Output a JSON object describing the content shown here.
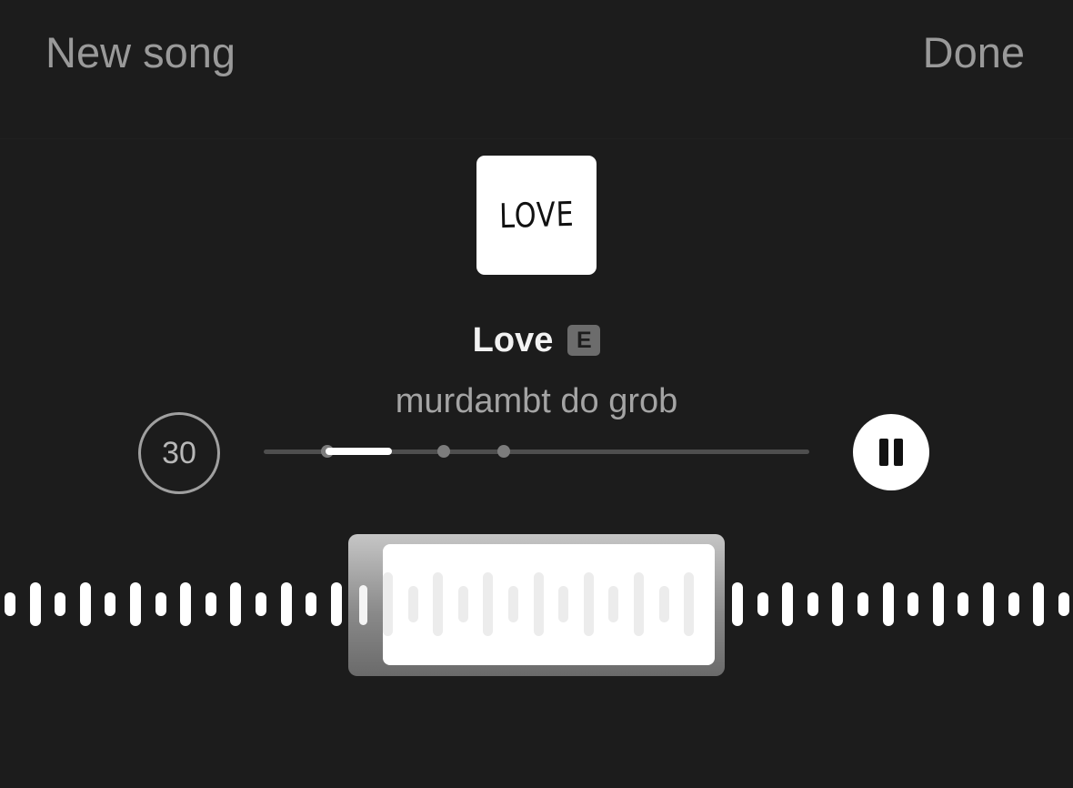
{
  "header": {
    "left_label": "New song",
    "right_label": "Done"
  },
  "album": {
    "art_text": "LOVE"
  },
  "track": {
    "title": "Love",
    "explicit_badge": "E",
    "artist": "murdambt do grob"
  },
  "controls": {
    "duration_label": "30"
  },
  "colors": {
    "background": "#1c1c1c",
    "accent": "#ffffff",
    "muted_text": "#9a9a9a"
  }
}
